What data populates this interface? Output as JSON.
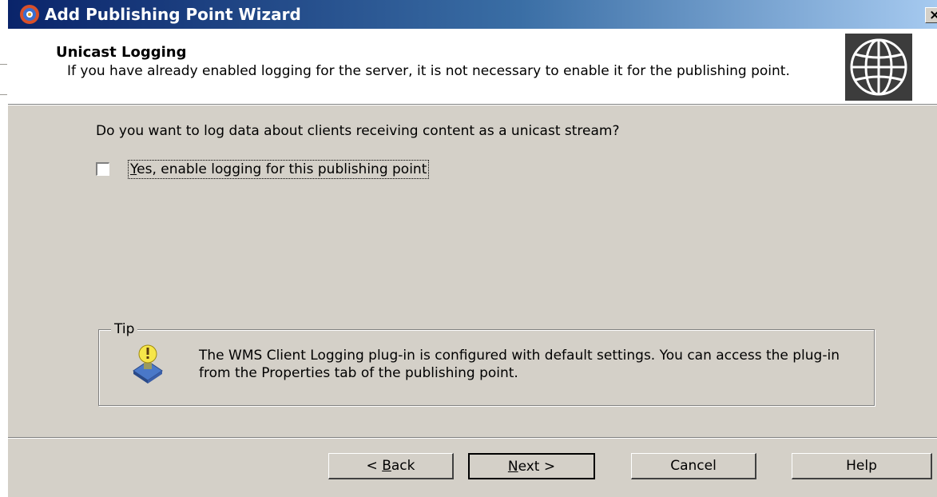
{
  "window": {
    "title": "Add Publishing Point Wizard",
    "close_label": "×",
    "icon": "wms-app-icon"
  },
  "header": {
    "title": "Unicast Logging",
    "subtitle": "If you have already enabled logging for the server, it is not necessary to enable it for the publishing point.",
    "image": "globe-icon"
  },
  "main": {
    "question": "Do you want to log data about clients receiving content as a unicast stream?",
    "checkbox": {
      "accelerator": "Y",
      "label_rest": "es, enable logging for this publishing point",
      "checked": false
    }
  },
  "tip": {
    "legend": "Tip",
    "icon": "tip-lightbulb-icon",
    "text": "The WMS Client Logging plug-in is configured with default settings. You can access the plug-in from the Properties tab of the publishing point."
  },
  "buttons": {
    "back_prefix": "< ",
    "back_accel": "B",
    "back_rest": "ack",
    "next_accel": "N",
    "next_rest": "ext >",
    "cancel": "Cancel",
    "help": "Help"
  },
  "colors": {
    "face": "#d4d0c8",
    "titlebar_start": "#0a246a",
    "titlebar_end": "#a6caf0",
    "header_bg": "#ffffff"
  }
}
